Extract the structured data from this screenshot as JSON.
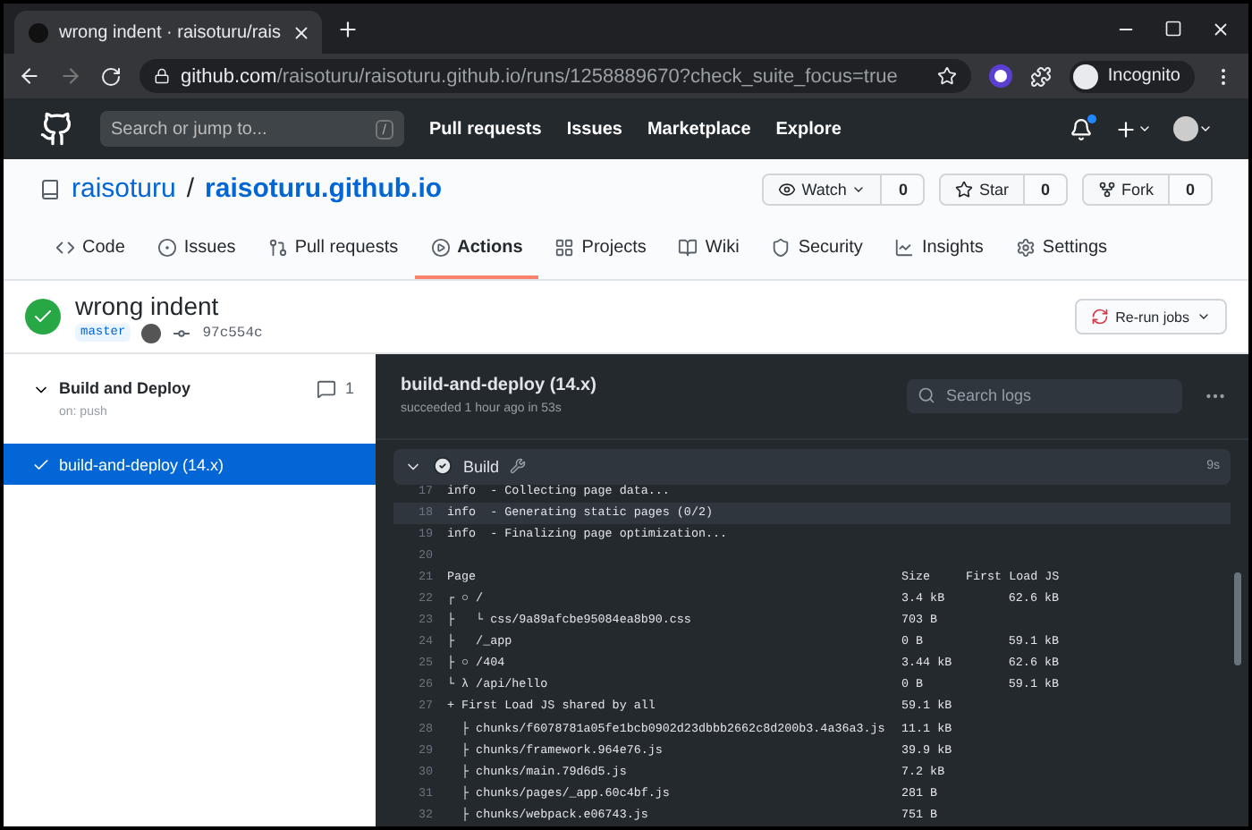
{
  "browser": {
    "tab_title": "wrong indent · raisoturu/rais",
    "url_domain": "github.com",
    "url_path": "/raisoturu/raisoturu.github.io/runs/1258889670?check_suite_focus=true",
    "profile": "Incognito"
  },
  "header": {
    "search_placeholder": "Search or jump to...",
    "search_key": "/",
    "nav": [
      "Pull requests",
      "Issues",
      "Marketplace",
      "Explore"
    ],
    "notification_unread": true
  },
  "repo": {
    "owner": "raisoturu",
    "separator": "/",
    "name": "raisoturu.github.io",
    "actions": [
      {
        "kind": "watch",
        "label": "Watch",
        "count": "0"
      },
      {
        "kind": "star",
        "label": "Star",
        "count": "0"
      },
      {
        "kind": "fork",
        "label": "Fork",
        "count": "0"
      }
    ]
  },
  "tabs": [
    {
      "kind": "code",
      "label": "Code",
      "selected": false
    },
    {
      "kind": "issues",
      "label": "Issues",
      "selected": false
    },
    {
      "kind": "pulls",
      "label": "Pull requests",
      "selected": false
    },
    {
      "kind": "actions",
      "label": "Actions",
      "selected": true
    },
    {
      "kind": "projects",
      "label": "Projects",
      "selected": false
    },
    {
      "kind": "wiki",
      "label": "Wiki",
      "selected": false
    },
    {
      "kind": "security",
      "label": "Security",
      "selected": false
    },
    {
      "kind": "insights",
      "label": "Insights",
      "selected": false
    },
    {
      "kind": "settings",
      "label": "Settings",
      "selected": false
    }
  ],
  "run": {
    "title": "wrong indent",
    "branch": "master",
    "commit": "97c554c",
    "rerun_label": "Re-run jobs"
  },
  "workflow": {
    "name": "Build and Deploy",
    "trigger": "on: push",
    "annotations": "1",
    "expanded": true,
    "jobs": [
      {
        "name": "build-and-deploy (14.x)",
        "selected": true
      }
    ]
  },
  "job": {
    "title": "build-and-deploy (14.x)",
    "summary": "succeeded 1 hour ago in 53s",
    "search_placeholder": "Search logs"
  },
  "step": {
    "name": "Build",
    "duration": "9s",
    "expanded": true,
    "lines": [
      {
        "number": "17",
        "text": "info  - Collecting page data...",
        "highlighted": false
      },
      {
        "number": "18",
        "text": "info  - Generating static pages (0/2)",
        "highlighted": true
      },
      {
        "number": "19",
        "text": "info  - Finalizing page optimization...",
        "highlighted": false
      },
      {
        "number": "20",
        "highlighted": false
      },
      {
        "number": "21",
        "text": "Page",
        "size": "Size",
        "first_load": "First Load JS",
        "highlighted": false
      },
      {
        "number": "22",
        "text": "┌ ○ /",
        "size": "3.4 kB",
        "first_load": "62.6 kB",
        "highlighted": false
      },
      {
        "number": "23",
        "text": "├   └ css/9a89afcbe95084ea8b90.css",
        "size": "703 B",
        "highlighted": false
      },
      {
        "number": "24",
        "text": "├   /_app",
        "size": "0 B",
        "first_load": "59.1 kB",
        "highlighted": false
      },
      {
        "number": "25",
        "text": "├ ○ /404",
        "size": "3.44 kB",
        "first_load": "62.6 kB",
        "highlighted": false
      },
      {
        "number": "26",
        "text": "└ λ /api/hello",
        "size": "0 B",
        "first_load": "59.1 kB",
        "highlighted": false
      },
      {
        "number": "27",
        "text": "+ First Load JS shared by all",
        "size": "59.1 kB",
        "highlighted": false
      },
      {
        "number": "28",
        "text": "  ├ chunks/f6078781a05fe1bcb0902d23dbbb2662c8d200b3.4a36a3.js",
        "size": "11.1 kB",
        "highlighted": false
      },
      {
        "number": "29",
        "text": "  ├ chunks/framework.964e76.js",
        "size": "39.9 kB",
        "highlighted": false
      },
      {
        "number": "30",
        "text": "  ├ chunks/main.79d6d5.js",
        "size": "7.2 kB",
        "highlighted": false
      },
      {
        "number": "31",
        "text": "  ├ chunks/pages/_app.60c4bf.js",
        "size": "281 B",
        "highlighted": false
      },
      {
        "number": "32",
        "text": "  ├ chunks/webpack.e06743.js",
        "size": "751 B",
        "highlighted": false
      }
    ]
  }
}
